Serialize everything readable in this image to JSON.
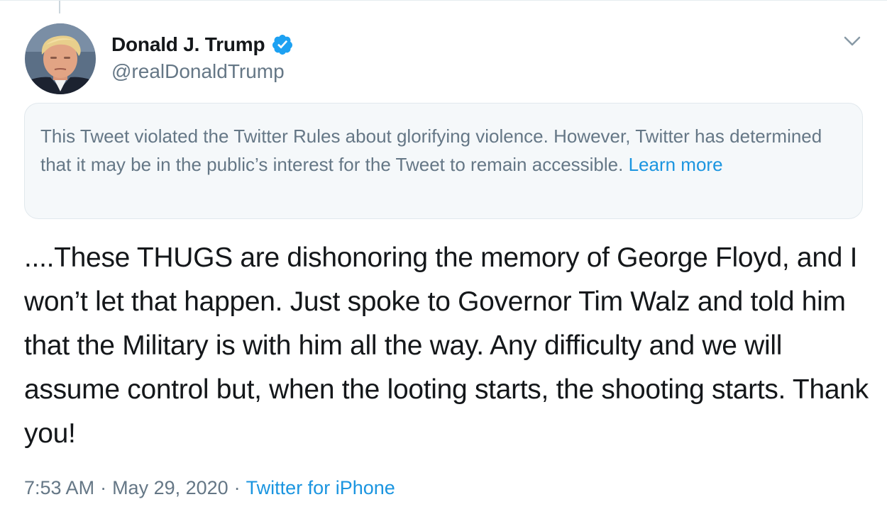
{
  "author": {
    "name": "Donald J. Trump",
    "handle": "@realDonaldTrump",
    "verified": true,
    "avatar_icon": "profile-photo-avatar"
  },
  "notice": {
    "text": "This Tweet violated the Twitter Rules about glorifying violence. However, Twitter has determined that it may be in the public’s interest for the Tweet to remain accessible.",
    "link_label": "Learn more"
  },
  "tweet": {
    "text": "....These THUGS are dishonoring the memory of George Floyd, and I won’t let that happen. Just spoke to Governor Tim Walz and told him that the Military is with him all the way. Any difficulty and we will assume control but, when the looting starts, the shooting starts. Thank you!"
  },
  "meta": {
    "time": "7:53 AM",
    "separator": "·",
    "date": "May 29, 2020",
    "source": "Twitter for iPhone"
  },
  "icons": {
    "verified": "verified-badge-icon",
    "menu": "chevron-down-icon"
  },
  "colors": {
    "link": "#1b95e0",
    "verified": "#1da1f2",
    "secondary_text": "#657786",
    "notice_bg": "#f5f8fa"
  }
}
